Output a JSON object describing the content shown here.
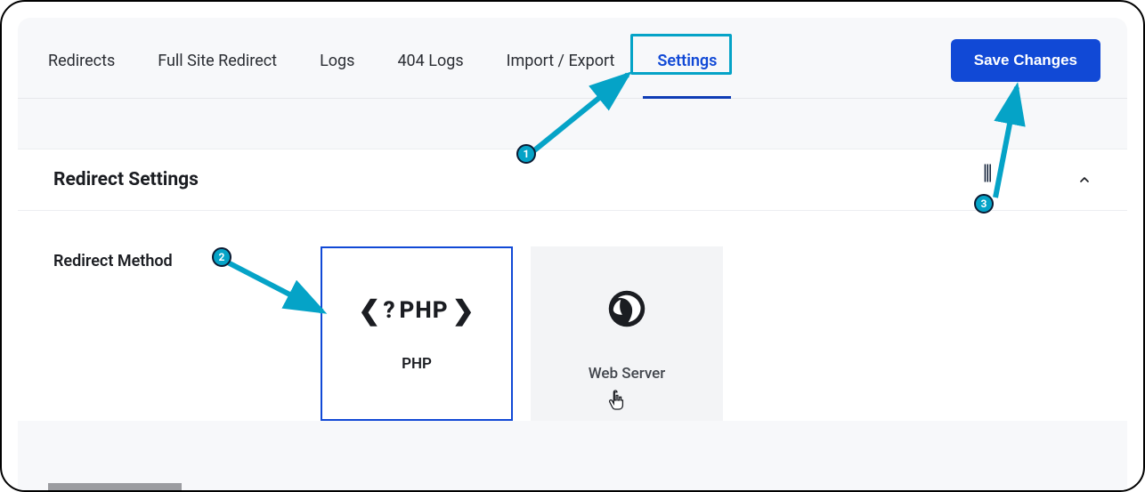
{
  "tabs": {
    "redirects": "Redirects",
    "full_site": "Full Site Redirect",
    "logs": "Logs",
    "logs_404": "404 Logs",
    "import_export": "Import / Export",
    "settings": "Settings"
  },
  "save_button": "Save Changes",
  "panel": {
    "title": "Redirect Settings",
    "method_label": "Redirect Method",
    "options": {
      "php": {
        "icon_text": "PHP",
        "label": "PHP"
      },
      "web_server": {
        "label": "Web Server"
      }
    }
  },
  "annotations": {
    "callout_1": "1",
    "callout_2": "2",
    "callout_3": "3"
  }
}
